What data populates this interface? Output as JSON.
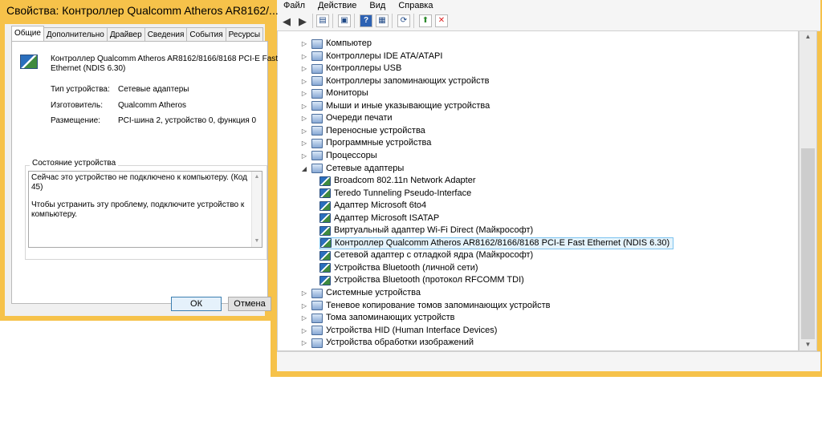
{
  "device_manager": {
    "menu": [
      "Файл",
      "Действие",
      "Вид",
      "Справка"
    ],
    "toolbar_icons": [
      "back-icon",
      "forward-icon",
      "properties-icon",
      "console-icon",
      "help-icon",
      "view-icon",
      "scan-icon",
      "update-driver-icon",
      "uninstall-icon"
    ],
    "tree": [
      {
        "label": "Компьютер",
        "level": 0,
        "expanded": false
      },
      {
        "label": "Контроллеры IDE ATA/ATAPI",
        "level": 0,
        "expanded": false
      },
      {
        "label": "Контроллеры USB",
        "level": 0,
        "expanded": false
      },
      {
        "label": "Контроллеры запоминающих устройств",
        "level": 0,
        "expanded": false
      },
      {
        "label": "Мониторы",
        "level": 0,
        "expanded": false
      },
      {
        "label": "Мыши и иные указывающие устройства",
        "level": 0,
        "expanded": false
      },
      {
        "label": "Очереди печати",
        "level": 0,
        "expanded": false
      },
      {
        "label": "Переносные устройства",
        "level": 0,
        "expanded": false
      },
      {
        "label": "Программные устройства",
        "level": 0,
        "expanded": false
      },
      {
        "label": "Процессоры",
        "level": 0,
        "expanded": false
      },
      {
        "label": "Сетевые адаптеры",
        "level": 0,
        "expanded": true
      },
      {
        "label": "Broadcom 802.11n Network Adapter",
        "level": 1
      },
      {
        "label": "Teredo Tunneling Pseudo-Interface",
        "level": 1
      },
      {
        "label": "Адаптер Microsoft 6to4",
        "level": 1
      },
      {
        "label": "Адаптер Microsoft ISATAP",
        "level": 1
      },
      {
        "label": "Виртуальный адаптер Wi-Fi Direct (Майкрософт)",
        "level": 1
      },
      {
        "label": "Контроллер Qualcomm Atheros AR8162/8166/8168 PCI-E Fast Ethernet (NDIS 6.30)",
        "level": 1,
        "selected": true
      },
      {
        "label": "Сетевой адаптер с отладкой ядра (Майкрософт)",
        "level": 1
      },
      {
        "label": "Устройства Bluetooth (личной сети)",
        "level": 1
      },
      {
        "label": "Устройства Bluetooth (протокол RFCOMM TDI)",
        "level": 1
      },
      {
        "label": "Системные устройства",
        "level": 0,
        "expanded": false
      },
      {
        "label": "Теневое копирование томов запоминающих устройств",
        "level": 0,
        "expanded": false
      },
      {
        "label": "Тома запоминающих устройств",
        "level": 0,
        "expanded": false
      },
      {
        "label": "Устройства HID (Human Interface Devices)",
        "level": 0,
        "expanded": false
      },
      {
        "label": "Устройства обработки изображений",
        "level": 0,
        "expanded": false
      }
    ]
  },
  "properties_dialog": {
    "title": "Свойства: Контроллер Qualcomm Atheros AR8162/...",
    "tabs": [
      "Общие",
      "Дополнительно",
      "Драйвер",
      "Сведения",
      "События",
      "Ресурсы"
    ],
    "active_tab": "Общие",
    "device_name_line1": "Контроллер Qualcomm Atheros AR8162/8166/8168 PCI-E Fast",
    "device_name_line2": "Ethernet (NDIS 6.30)",
    "props": {
      "type_label": "Тип устройства:",
      "type_value": "Сетевые адаптеры",
      "maker_label": "Изготовитель:",
      "maker_value": "Qualcomm Atheros",
      "location_label": "Размещение:",
      "location_value": "PCI-шина 2, устройство 0, функция 0"
    },
    "status_group_label": "Состояние устройства",
    "status_line1": "Сейчас это устройство не подключено к компьютеру. (Код",
    "status_line2": "45)",
    "status_line3": "Чтобы устранить эту проблему, подключите устройство к",
    "status_line4": "компьютеру.",
    "ok_label": "ОК",
    "cancel_label": "Отмена"
  },
  "colors": {
    "window_frame": "#f6c24a",
    "selection_bg": "#e5f3fb",
    "selection_border": "#7dc4f0"
  }
}
